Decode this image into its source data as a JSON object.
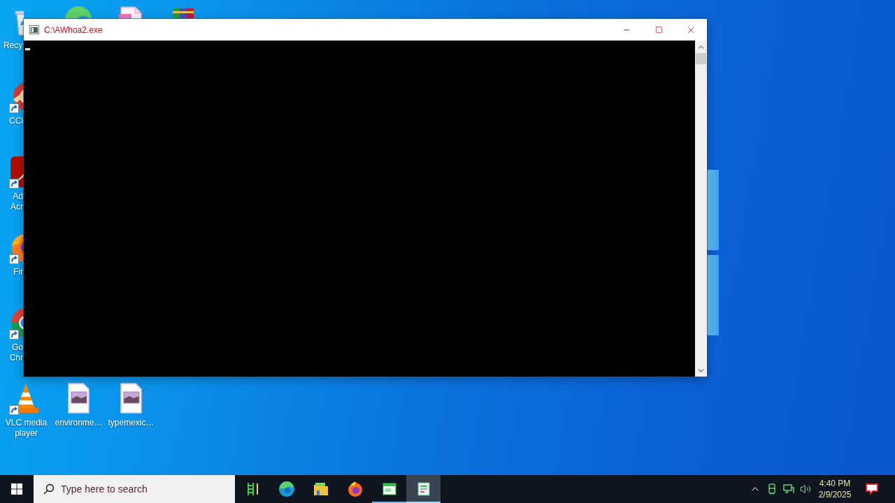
{
  "desktop_icons": [
    {
      "kind": "bin",
      "label": "Recy",
      "shortcut": false
    },
    {
      "kind": "swirl"
    },
    {
      "kind": "document"
    },
    {
      "kind": "books"
    },
    {
      "kind": "cleaner",
      "label": "CCl",
      "shortcut": true
    },
    {
      "kind": "tile",
      "label": "Ad\nAcr",
      "shortcut": true
    },
    {
      "kind": "fox",
      "label": "Fir",
      "shortcut": true
    },
    {
      "kind": "ring",
      "label": "Go\nChr",
      "shortcut": true
    },
    {
      "kind": "cone",
      "label": "VLC media player",
      "shortcut": true
    },
    {
      "kind": "image-file",
      "label": "environme…",
      "shortcut": false
    },
    {
      "kind": "image-file",
      "label": "typemexic…",
      "shortcut": false
    }
  ],
  "window": {
    "title": "C:\\AWhoa2.exe",
    "cursor": true
  },
  "taskbar": {
    "search": {
      "placeholder": "Type here to search"
    },
    "apps": [
      {
        "kind": "bars",
        "selected": false,
        "running": false
      },
      {
        "kind": "swirl",
        "selected": false,
        "running": false
      },
      {
        "kind": "folder",
        "selected": false,
        "running": false
      },
      {
        "kind": "flame",
        "selected": false,
        "running": false
      },
      {
        "kind": "app-window",
        "selected": false,
        "running": true
      },
      {
        "kind": "document-window",
        "selected": true,
        "running": true
      }
    ],
    "clock": {
      "time": "4:40 PM",
      "date": "2/9/2025"
    }
  }
}
